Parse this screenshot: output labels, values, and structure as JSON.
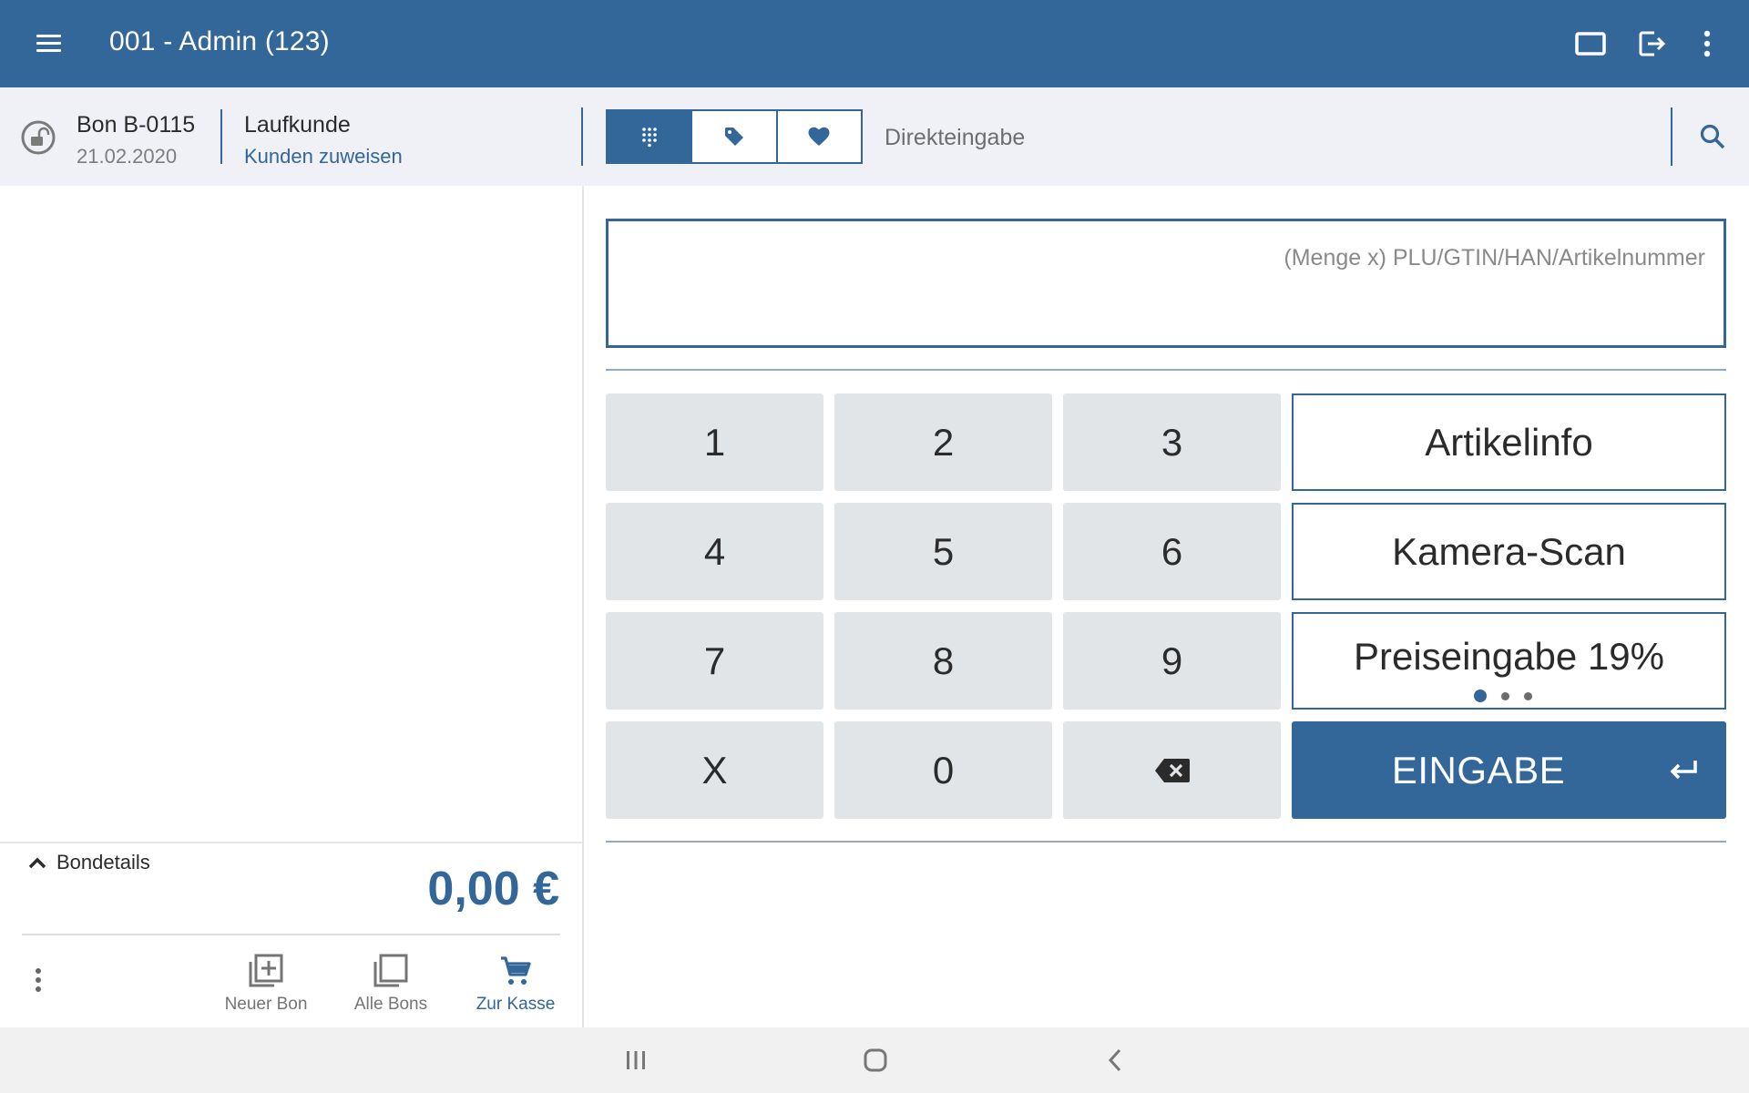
{
  "header": {
    "title": "001 - Admin (123)",
    "background_color": "#336699",
    "menu_icon": "hamburger-menu-icon",
    "actions": [
      "fullscreen-icon",
      "logout-icon",
      "more-vert-icon"
    ]
  },
  "receipt": {
    "status_icon": "lock-open-icon",
    "number": "Bon B-0115",
    "date": "21.02.2020"
  },
  "customer": {
    "name": "Laufkunde",
    "assign_link": "Kunden zuweisen"
  },
  "input_mode": {
    "tabs": [
      {
        "icon": "dialpad-icon",
        "selected": true
      },
      {
        "icon": "tag-icon",
        "selected": false
      },
      {
        "icon": "heart-icon",
        "selected": false
      }
    ],
    "label": "Direkteingabe",
    "search_icon": "search-icon"
  },
  "entry": {
    "value": "",
    "placeholder": "(Menge x) PLU/GTIN/HAN/Artikelnummer"
  },
  "keypad": {
    "keys": [
      "1",
      "2",
      "3",
      "4",
      "5",
      "6",
      "7",
      "8",
      "9",
      "X",
      "0"
    ],
    "backspace_icon": "backspace-icon"
  },
  "functions": {
    "buttons": [
      "Artikelinfo",
      "Kamera-Scan",
      "Preiseingabe 19%"
    ],
    "pager": {
      "pages": 3,
      "current": 1
    }
  },
  "enter": {
    "label": "EINGABE",
    "icon": "return-arrow-icon"
  },
  "summary": {
    "details_label": "Bondetails",
    "details_icon": "chevron-up-icon",
    "total": "0,00 €",
    "total_color": "#336699"
  },
  "bottom_actions": {
    "more_icon": "more-vert-icon",
    "items": [
      {
        "label": "Neuer Bon",
        "icon": "add-receipt-icon",
        "active": false
      },
      {
        "label": "Alle Bons",
        "icon": "receipts-stack-icon",
        "active": false
      },
      {
        "label": "Zur Kasse",
        "icon": "cart-icon",
        "active": true
      }
    ]
  },
  "system_nav": [
    "recent-apps-icon",
    "home-icon",
    "back-icon"
  ]
}
